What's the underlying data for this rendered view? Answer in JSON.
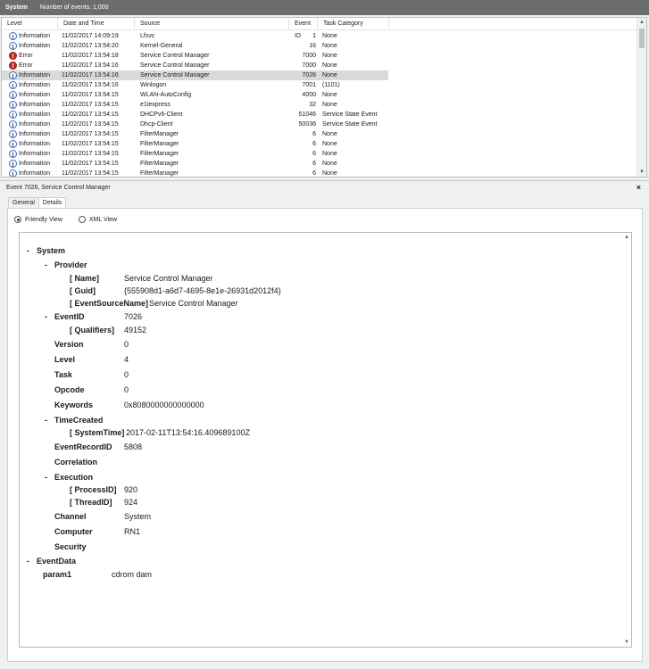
{
  "header": {
    "title": "System",
    "count": "Number of events: 1,000"
  },
  "columns": {
    "level": "Level",
    "date": "Date and Time",
    "source": "Source",
    "event_id": "Event ID",
    "task": "Task Category"
  },
  "events": [
    {
      "icon": "info",
      "level": "Information",
      "date": "11/02/2017 14:09:19",
      "source": "Lfsvc",
      "id": "1",
      "task": "None"
    },
    {
      "icon": "info",
      "level": "Information",
      "date": "11/02/2017 13:54:20",
      "source": "Kernel-General",
      "id": "16",
      "task": "None"
    },
    {
      "icon": "err",
      "level": "Error",
      "date": "11/02/2017 13:54:18",
      "source": "Service Control Manager",
      "id": "7000",
      "task": "None"
    },
    {
      "icon": "err",
      "level": "Error",
      "date": "11/02/2017 13:54:16",
      "source": "Service Control Manager",
      "id": "7000",
      "task": "None"
    },
    {
      "icon": "info",
      "level": "Information",
      "date": "11/02/2017 13:54:16",
      "source": "Service Control Manager",
      "id": "7026",
      "task": "None",
      "selected": true
    },
    {
      "icon": "info",
      "level": "Information",
      "date": "11/02/2017 13:54:16",
      "source": "Winlogon",
      "id": "7001",
      "task": "(1101)"
    },
    {
      "icon": "info",
      "level": "Information",
      "date": "11/02/2017 13:54:15",
      "source": "WLAN-AutoConfig",
      "id": "4000",
      "task": "None"
    },
    {
      "icon": "info",
      "level": "Information",
      "date": "11/02/2017 13:54:15",
      "source": "e1iexpress",
      "id": "32",
      "task": "None"
    },
    {
      "icon": "info",
      "level": "Information",
      "date": "11/02/2017 13:54:15",
      "source": "DHCPv6-Client",
      "id": "51046",
      "task": "Service State Event"
    },
    {
      "icon": "info",
      "level": "Information",
      "date": "11/02/2017 13:54:15",
      "source": "Dhcp-Client",
      "id": "50036",
      "task": "Service State Event"
    },
    {
      "icon": "info",
      "level": "Information",
      "date": "11/02/2017 13:54:15",
      "source": "FilterManager",
      "id": "6",
      "task": "None"
    },
    {
      "icon": "info",
      "level": "Information",
      "date": "11/02/2017 13:54:15",
      "source": "FilterManager",
      "id": "6",
      "task": "None"
    },
    {
      "icon": "info",
      "level": "Information",
      "date": "11/02/2017 13:54:15",
      "source": "FilterManager",
      "id": "6",
      "task": "None"
    },
    {
      "icon": "info",
      "level": "Information",
      "date": "11/02/2017 13:54:15",
      "source": "FilterManager",
      "id": "6",
      "task": "None"
    },
    {
      "icon": "info",
      "level": "Information",
      "date": "11/02/2017 13:54:15",
      "source": "FilterManager",
      "id": "6",
      "task": "None"
    }
  ],
  "detail": {
    "title": "Event 7026, Service Control Manager",
    "close": "×",
    "tabs": [
      "General",
      "Details"
    ],
    "radio_friendly": "Friendly View",
    "radio_xml": "XML View",
    "tree": [
      {
        "kind": "toggle",
        "text": "-"
      },
      {
        "kind": "label",
        "text": "System"
      },
      {
        "kind": "toggle",
        "text": "-"
      },
      {
        "kind": "label",
        "text": "Provider"
      },
      {
        "kind": "attr",
        "text": "[ Name]",
        "value": "Service Control Manager"
      },
      {
        "kind": "attr",
        "text": "[ Guid]",
        "value": "{555908d1-a6d7-4695-8e1e-26931d2012f4}"
      },
      {
        "kind": "attr",
        "text": "[ EventSourceName]",
        "value": "Service Control Manager"
      },
      {
        "kind": "toggle",
        "text": "-"
      },
      {
        "kind": "label",
        "text": "EventID",
        "value": "7026"
      },
      {
        "kind": "attr",
        "text": "[ Qualifiers]",
        "value": "49152"
      },
      {
        "kind": "label",
        "text": "Version",
        "value": "0"
      },
      {
        "kind": "label",
        "text": "Level",
        "value": "4"
      },
      {
        "kind": "label",
        "text": "Task",
        "value": "0"
      },
      {
        "kind": "label",
        "text": "Opcode",
        "value": "0"
      },
      {
        "kind": "label",
        "text": "Keywords",
        "value": "0x8080000000000000"
      },
      {
        "kind": "toggle",
        "text": "-"
      },
      {
        "kind": "label",
        "text": "TimeCreated"
      },
      {
        "kind": "attr",
        "text": "[ SystemTime]",
        "value": "2017-02-11T13:54:16.409689100Z"
      },
      {
        "kind": "label",
        "text": "EventRecordID",
        "value": "5808"
      },
      {
        "kind": "label",
        "text": "Correlation"
      },
      {
        "kind": "toggle",
        "text": "-"
      },
      {
        "kind": "label",
        "text": "Execution"
      },
      {
        "kind": "attr",
        "text": "[ ProcessID]",
        "value": "920"
      },
      {
        "kind": "attr",
        "text": "[ ThreadID]",
        "value": "924"
      },
      {
        "kind": "label",
        "text": "Channel",
        "value": "System"
      },
      {
        "kind": "label",
        "text": "Computer",
        "value": "RN1"
      },
      {
        "kind": "label",
        "text": "Security"
      },
      {
        "kind": "toggle",
        "text": "-"
      },
      {
        "kind": "label",
        "text": "EventData"
      },
      {
        "kind": "label",
        "text": "param1",
        "value": "cdrom dam"
      }
    ]
  }
}
